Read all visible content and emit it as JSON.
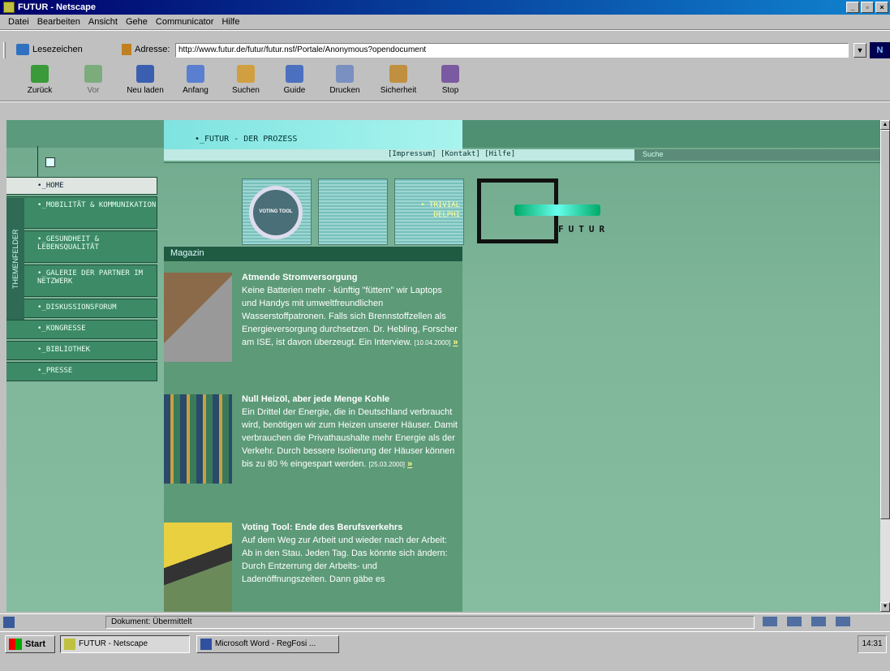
{
  "window": {
    "title": "FUTUR - Netscape"
  },
  "menu": [
    "Datei",
    "Bearbeiten",
    "Ansicht",
    "Gehe",
    "Communicator",
    "Hilfe"
  ],
  "location": {
    "bookmarks_label": "Lesezeichen",
    "address_label": "Adresse:",
    "url": "http://www.futur.de/futur/futur.nsf/Portale/Anonymous?opendocument"
  },
  "toolbar": [
    "Zurück",
    "Vor",
    "Neu laden",
    "Anfang",
    "Suchen",
    "Guide",
    "Drucken",
    "Sicherheit",
    "Stop"
  ],
  "page": {
    "prozess": "•_FUTUR - DER PROZESS",
    "top_links": "[Impressum] [Kontakt] [Hilfe]",
    "search": "Suche",
    "themenfelder": "THEMENFELDER",
    "nav": [
      "•_HOME",
      "•_MOBILITÄT & KOMMUNIKATION",
      "•_GESUNDHEIT & LEBENSQUALITÄT",
      "•_GALERIE DER PARTNER IM NETZWERK",
      "•_DISKUSSIONSFORUM",
      "•_KONGRESSE",
      "•_BIBLIOTHEK",
      "•_PRESSE"
    ],
    "tiles": {
      "voting": "VOTING TOOL",
      "trivial": "• TRIVIAL DELPHI"
    },
    "logo_text": "FUTUR",
    "magazine_label": "Magazin",
    "articles": [
      {
        "title": "Atmende Stromversorgung",
        "body": "Keine Batterien mehr - künftig \"füttern\" wir Laptops und Handys mit umweltfreundlichen Wasserstoffpatronen. Falls sich Brennstoffzellen als Energieversorgung durchsetzen. Dr. Hebling, Forscher am ISE, ist davon überzeugt. Ein Interview.",
        "date": "[10.04.2000]",
        "more": "»"
      },
      {
        "title": "Null Heizöl, aber jede Menge Kohle",
        "body": "Ein Drittel der Energie, die in Deutschland verbraucht wird, benötigen wir zum Heizen unserer Häuser. Damit verbrauchen die Privathaushalte mehr Energie als der Verkehr. Durch bessere Isolierung der Häuser können bis zu 80 % eingespart werden.",
        "date": "[25.03.2000]",
        "more": "»"
      },
      {
        "title": "Voting Tool: Ende des Berufsverkehrs",
        "body": "Auf dem Weg zur Arbeit und wieder nach der Arbeit: Ab in den Stau. Jeden Tag. Das könnte sich ändern: Durch Entzerrung der Arbeits- und Ladenöffnungszeiten. Dann gäbe es",
        "date": "",
        "more": ""
      }
    ]
  },
  "status": {
    "text": "Dokument: Übermittelt"
  },
  "taskbar": {
    "start": "Start",
    "tasks": [
      "FUTUR - Netscape",
      "Microsoft Word - RegFosi ..."
    ],
    "clock": "14:31"
  }
}
